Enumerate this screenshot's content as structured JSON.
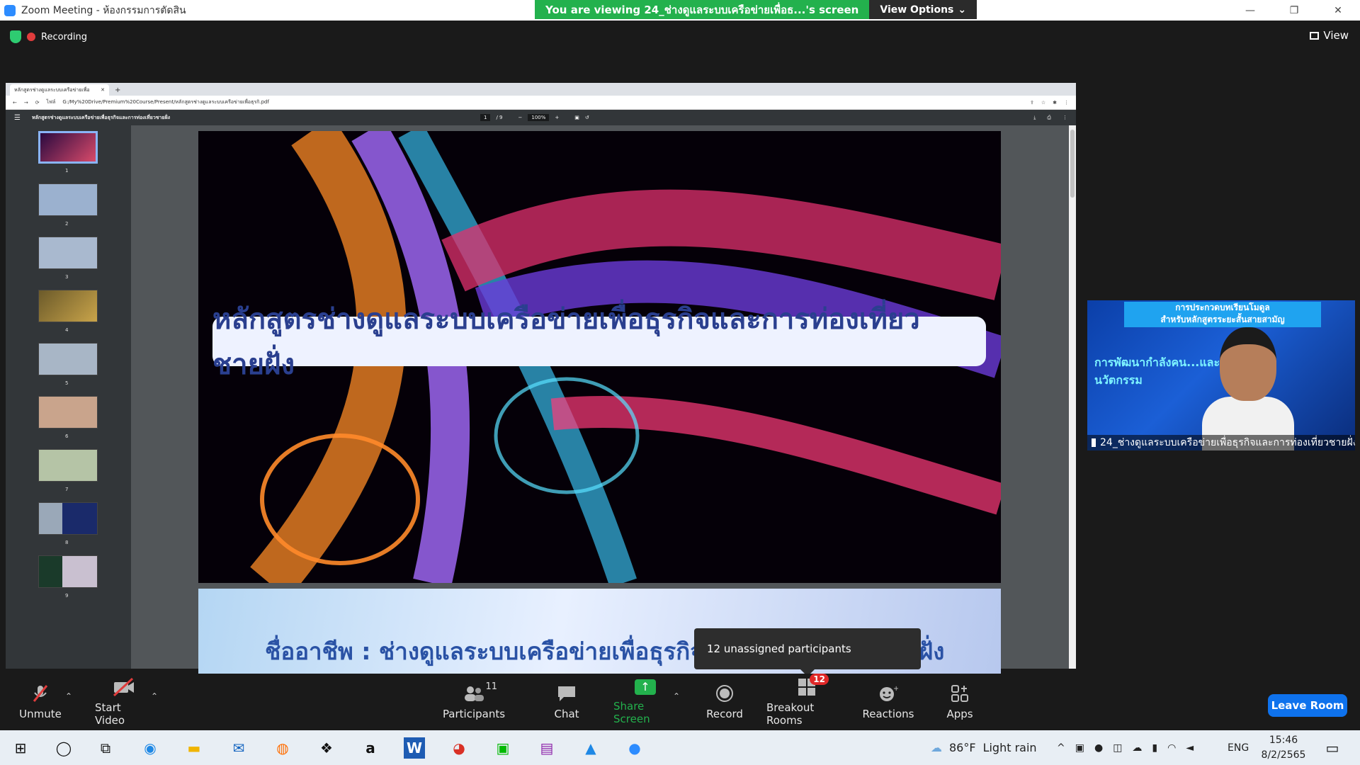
{
  "window": {
    "title": "Zoom Meeting - ห้องกรรมการตัดสิน",
    "controls": {
      "minimize": "—",
      "restore": "❐",
      "close": "✕"
    }
  },
  "viewing_banner": {
    "message": "You are viewing 24_ช่างดูแลระบบเครือข่ายเพื่อธ...'s screen",
    "options_label": "View Options",
    "options_caret": "⌄"
  },
  "recording": {
    "label": "Recording"
  },
  "view_button": {
    "label": "View"
  },
  "shared_screen": {
    "browser": {
      "tab_title": "หลักสูตรช่างดูแลระบบเครือข่ายเพื่อ",
      "tab_close": "✕",
      "new_tab": "+",
      "nav": {
        "back": "←",
        "forward": "→",
        "reload": "⟳"
      },
      "info_label": "ไฟล์",
      "url": "G:/My%20Drive/Premium%20Course/Present/หลักสูตรช่างดูแลระบบเครือข่ายเพื่อธุรกิ.pdf",
      "tools": {
        "share": "⇪",
        "star": "☆",
        "extensions": "✱",
        "menu": "⋮"
      }
    },
    "pdf": {
      "menu_icon": "☰",
      "title": "หลักสูตรช่างดูแลระบบเครือข่ายเพื่อธุรกิจและการท่องเที่ยวชายฝั่ง",
      "page_current": "1",
      "page_total": "/ 9",
      "zoom_out": "−",
      "zoom": "100%",
      "zoom_in": "+",
      "fit": "▣",
      "rotate": "↺",
      "download": "⤓",
      "print": "⎙",
      "more": "⋮",
      "thumbnails": [
        "1",
        "2",
        "3",
        "4",
        "5",
        "6",
        "7",
        "8",
        "9"
      ],
      "page1_title": "หลักสูตรช่างดูแลระบบเครือข่ายเพื่อธุรกิจและการท่องเที่ยวชายฝั่ง",
      "page2_text": "ชื่ออาชีพ : ช่างดูแลระบบเครือข่ายเพื่อธุรกิจและการท่องเที่ยวชายฝั่ง"
    }
  },
  "tooltip": {
    "text": "12 unassigned participants"
  },
  "video_tile": {
    "banner_line1": "การประกวดบทเรียนโมดูล",
    "banner_line2": "สำหรับหลักสูตรระยะสั้นสายสามัญ",
    "banner_heading": "การพัฒนากำลังคน...และนวัตกรรม",
    "participant_name": "24_ช่างดูแลระบบเครือข่ายเพื่อธุรกิจและการท่องเที่ยวชายฝั่ง"
  },
  "toolbar": {
    "unmute": "Unmute",
    "start_video": "Start Video",
    "participants": "Participants",
    "participants_count": "11",
    "chat": "Chat",
    "share_screen": "Share Screen",
    "record": "Record",
    "breakout_rooms": "Breakout Rooms",
    "breakout_count": "12",
    "reactions": "Reactions",
    "apps": "Apps",
    "leave": "Leave Room",
    "caret": "⌃"
  },
  "taskbar": {
    "weather_temp": "86°F",
    "weather_desc": "Light rain",
    "language": "ENG",
    "time": "15:46",
    "date": "8/2/2565",
    "icons": {
      "start": "⊞",
      "search": "◯",
      "task_view": "⧉",
      "edge": "◉",
      "explorer": "▬",
      "mail": "✉",
      "firefox": "◍",
      "dropbox": "❖",
      "amazon": "a",
      "word": "W",
      "chrome": "◕",
      "line": "▣",
      "winrar": "▤",
      "photos": "▲",
      "zoom": "●",
      "tray_chevron": "^",
      "notifications": "▭"
    }
  },
  "colors": {
    "accent_green": "#23b14d",
    "leave_blue": "#0e72ed",
    "badge_red": "#e02828"
  }
}
